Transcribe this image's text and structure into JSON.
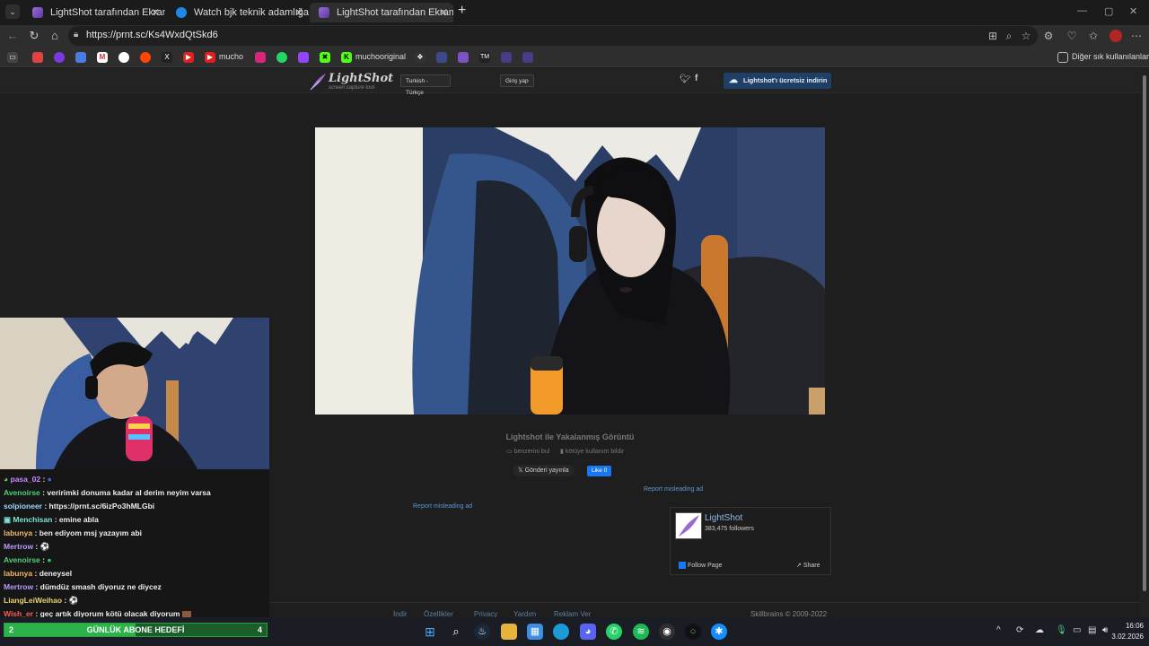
{
  "tabs": [
    {
      "title": "LightShot tarafından Ekran Görüntüsü",
      "active": false
    },
    {
      "title": "Watch bjk teknik adamlığa ilk adım",
      "active": false
    },
    {
      "title": "LightShot tarafından Ekran Görüntüsü",
      "active": true
    }
  ],
  "address_bar": {
    "url": "https://prnt.sc/Ks4WxdQtSkd6"
  },
  "bookmarks": [
    {
      "label": "",
      "icon": "reddit-icon"
    },
    {
      "label": "mucho",
      "icon": "youtube-icon"
    },
    {
      "label": "muchooriginal",
      "icon": "kick-icon"
    },
    {
      "label": "TM",
      "icon": "tm-icon"
    }
  ],
  "bookmarks_other": "Diğer sık kullanılanlar",
  "lightshot": {
    "logo": "LightShot",
    "logo_sub": "screen capture tool",
    "language": "Turkish - Türkçe",
    "login": "Giriş yap",
    "twitter": "t",
    "facebook": "f",
    "download": "Lightshot'ı ücretsiz indirin",
    "caption": "Lightshot ile Yakalanmış Görüntü",
    "similar": "benzerini bul",
    "report_abuse": "kötüye kullanım bildir",
    "tweet": "Gönderi yayınla",
    "like": "Like 0",
    "report_ad_1": "Report misleading ad",
    "report_ad_2": "Report misleading ad",
    "fb_page_name": "LightShot",
    "fb_followers": "383,475 followers",
    "fb_follow": "Follow Page",
    "fb_share": "Share",
    "footer_links": [
      "İndir",
      "Özellikler",
      "Privacy",
      "Yardım",
      "Reklam Ver"
    ],
    "footer_copyright": "Skillbrains © 2009-2022"
  },
  "chat": [
    {
      "user": "pasa_02",
      "text": "",
      "color": "#c78bff"
    },
    {
      "user": "Avenoirse",
      "text": "veririmki donuma kadar al derim neyim varsa",
      "color": "#4fd07a"
    },
    {
      "user": "solpioneer",
      "text": "https://prnt.sc/6izPo3hMLGbi",
      "color": "#9ad6ff"
    },
    {
      "user": "Menchisan",
      "text": "emine abla",
      "color": "#7fe3d6"
    },
    {
      "user": "labunya",
      "text": "ben ediyom msj yazayım abi",
      "color": "#f0b86a"
    },
    {
      "user": "Mertrow",
      "text": "",
      "color": "#b69cff"
    },
    {
      "user": "Avenoirse",
      "text": "",
      "color": "#4fd07a"
    },
    {
      "user": "labunya",
      "text": "deneysel",
      "color": "#f0b86a"
    },
    {
      "user": "Mertrow",
      "text": "dümdüz smash diyoruz ne diycez",
      "color": "#b69cff"
    },
    {
      "user": "LiangLeiWeihao",
      "text": "",
      "color": "#e6d36e"
    },
    {
      "user": "Wish_er",
      "text": "geç artık diyorum kötü olacak diyorum",
      "color": "#ff5a5a"
    }
  ],
  "sub_goal": {
    "current": "2",
    "label": "GÜNLÜK ABONE HEDEFİ",
    "target": "4",
    "progress": 0.5
  },
  "clock": {
    "time": "16:06",
    "date": "3.02.2026"
  }
}
